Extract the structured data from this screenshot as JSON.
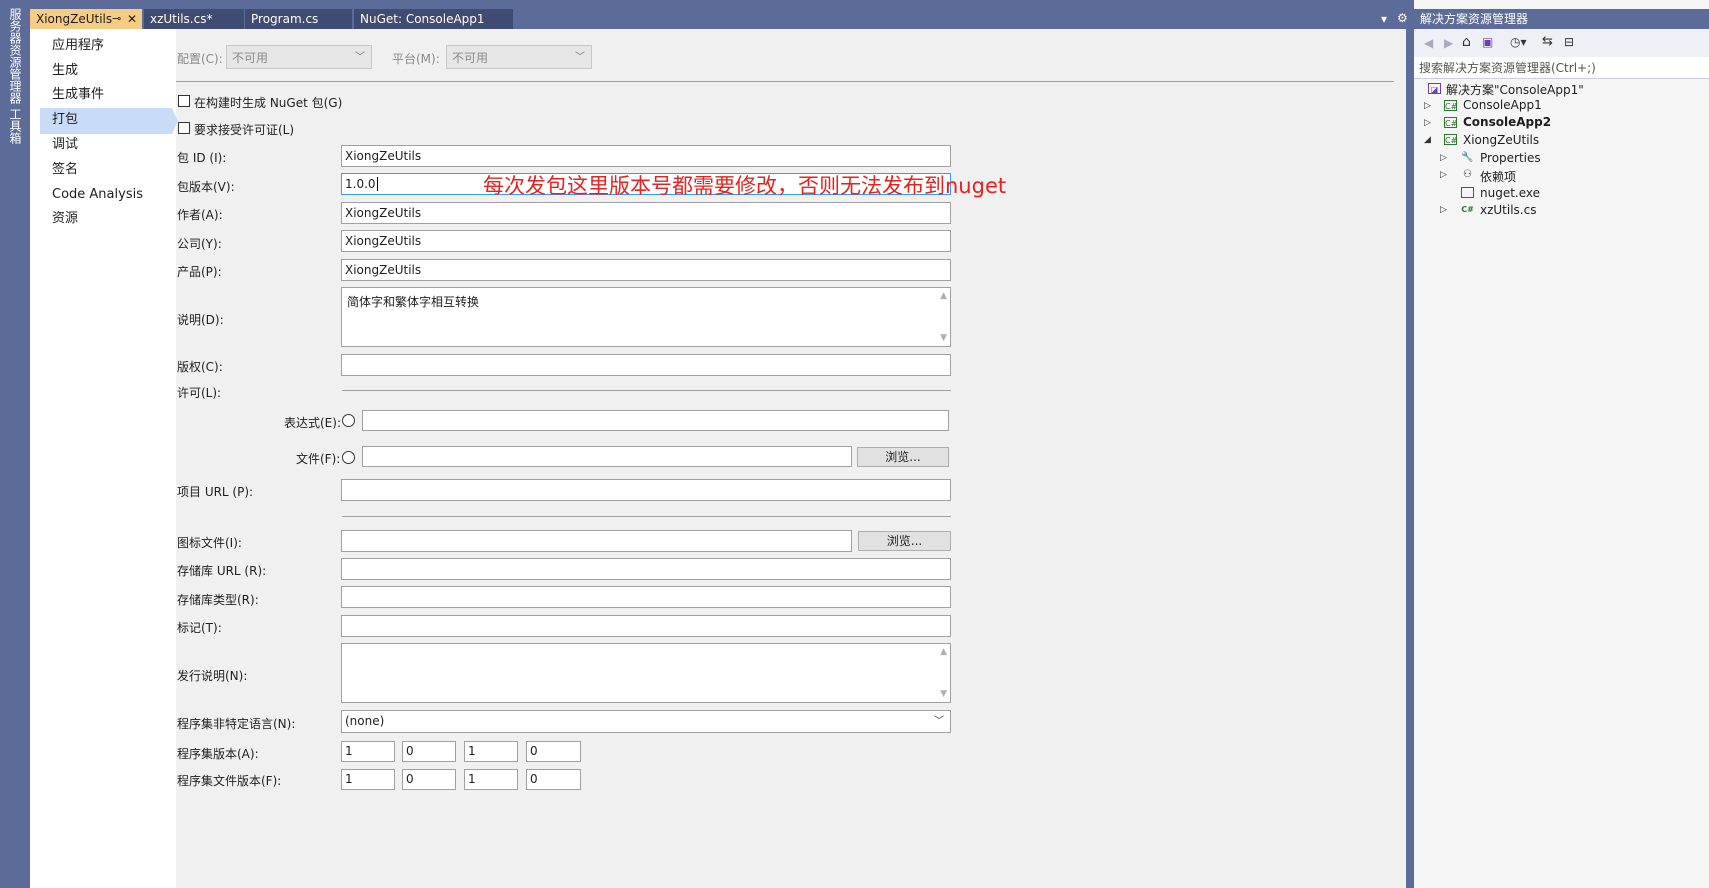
{
  "left_strip": {
    "server_explorer": "服务器资源管理器",
    "toolbox": "工具箱"
  },
  "tabs": [
    {
      "label": "XiongZeUtils",
      "active": true
    },
    {
      "label": "xzUtils.cs*",
      "active": false
    },
    {
      "label": "Program.cs",
      "active": false
    },
    {
      "label": "NuGet: ConsoleApp1",
      "active": false
    }
  ],
  "nav": {
    "items": [
      "应用程序",
      "生成",
      "生成事件",
      "打包",
      "调试",
      "签名",
      "Code Analysis",
      "资源"
    ],
    "selected": "打包"
  },
  "config": {
    "config_label": "配置(C):",
    "config_value": "不可用",
    "platform_label": "平台(M):",
    "platform_value": "不可用"
  },
  "checkboxes": {
    "generate_on_build": "在构建时生成 NuGet 包(G)",
    "require_license": "要求接受许可证(L)"
  },
  "fields": {
    "package_id_label": "包 ID (I):",
    "package_id": "XiongZeUtils",
    "version_label": "包版本(V):",
    "version": "1.0.0",
    "authors_label": "作者(A):",
    "authors": "XiongZeUtils",
    "company_label": "公司(Y):",
    "company": "XiongZeUtils",
    "product_label": "产品(P):",
    "product": "XiongZeUtils",
    "description_label": "说明(D):",
    "description": "简体字和繁体字相互转换",
    "copyright_label": "版权(C):",
    "copyright": "",
    "license_label": "许可(L):",
    "expression_label": "表达式(E):",
    "expression": "",
    "file_label": "文件(F):",
    "file": "",
    "browse": "浏览...",
    "project_url_label": "项目 URL (P):",
    "project_url": "",
    "icon_label": "图标文件(I):",
    "icon": "",
    "repo_url_label": "存储库 URL (R):",
    "repo_url": "",
    "repo_type_label": "存储库类型(R):",
    "repo_type": "",
    "tags_label": "标记(T):",
    "tags": "",
    "release_notes_label": "发行说明(N):",
    "release_notes": "",
    "neutral_lang_label": "程序集非特定语言(N):",
    "neutral_lang": "(none)",
    "assembly_version_label": "程序集版本(A):",
    "assembly_version": [
      "1",
      "0",
      "1",
      "0"
    ],
    "file_version_label": "程序集文件版本(F):",
    "file_version": [
      "1",
      "0",
      "1",
      "0"
    ]
  },
  "annotation": "每次发包这里版本号都需要修改，否则无法发布到nuget",
  "solution_explorer": {
    "title": "解决方案资源管理器",
    "search_placeholder": "搜索解决方案资源管理器(Ctrl+;)",
    "tree": [
      {
        "label": "解决方案\"ConsoleApp1\"",
        "icon": "solution-icon",
        "bold": false
      },
      {
        "label": "ConsoleApp1",
        "icon": "csharp-project-icon",
        "bold": false
      },
      {
        "label": "ConsoleApp2",
        "icon": "csharp-project-icon",
        "bold": true
      },
      {
        "label": "XiongZeUtils",
        "icon": "csharp-project-icon",
        "bold": false
      },
      {
        "label": "Properties",
        "icon": "properties-icon",
        "bold": false
      },
      {
        "label": "依赖项",
        "icon": "dependencies-icon",
        "bold": false
      },
      {
        "label": "nuget.exe",
        "icon": "file-icon",
        "bold": false
      },
      {
        "label": "xzUtils.cs",
        "icon": "csharp-file-icon",
        "bold": false
      }
    ]
  },
  "colors": {
    "chrome": "#5d6b99",
    "active_tab": "#f5cc84",
    "nav_selected": "#c9dcf7",
    "annotation": "#e8211e"
  }
}
